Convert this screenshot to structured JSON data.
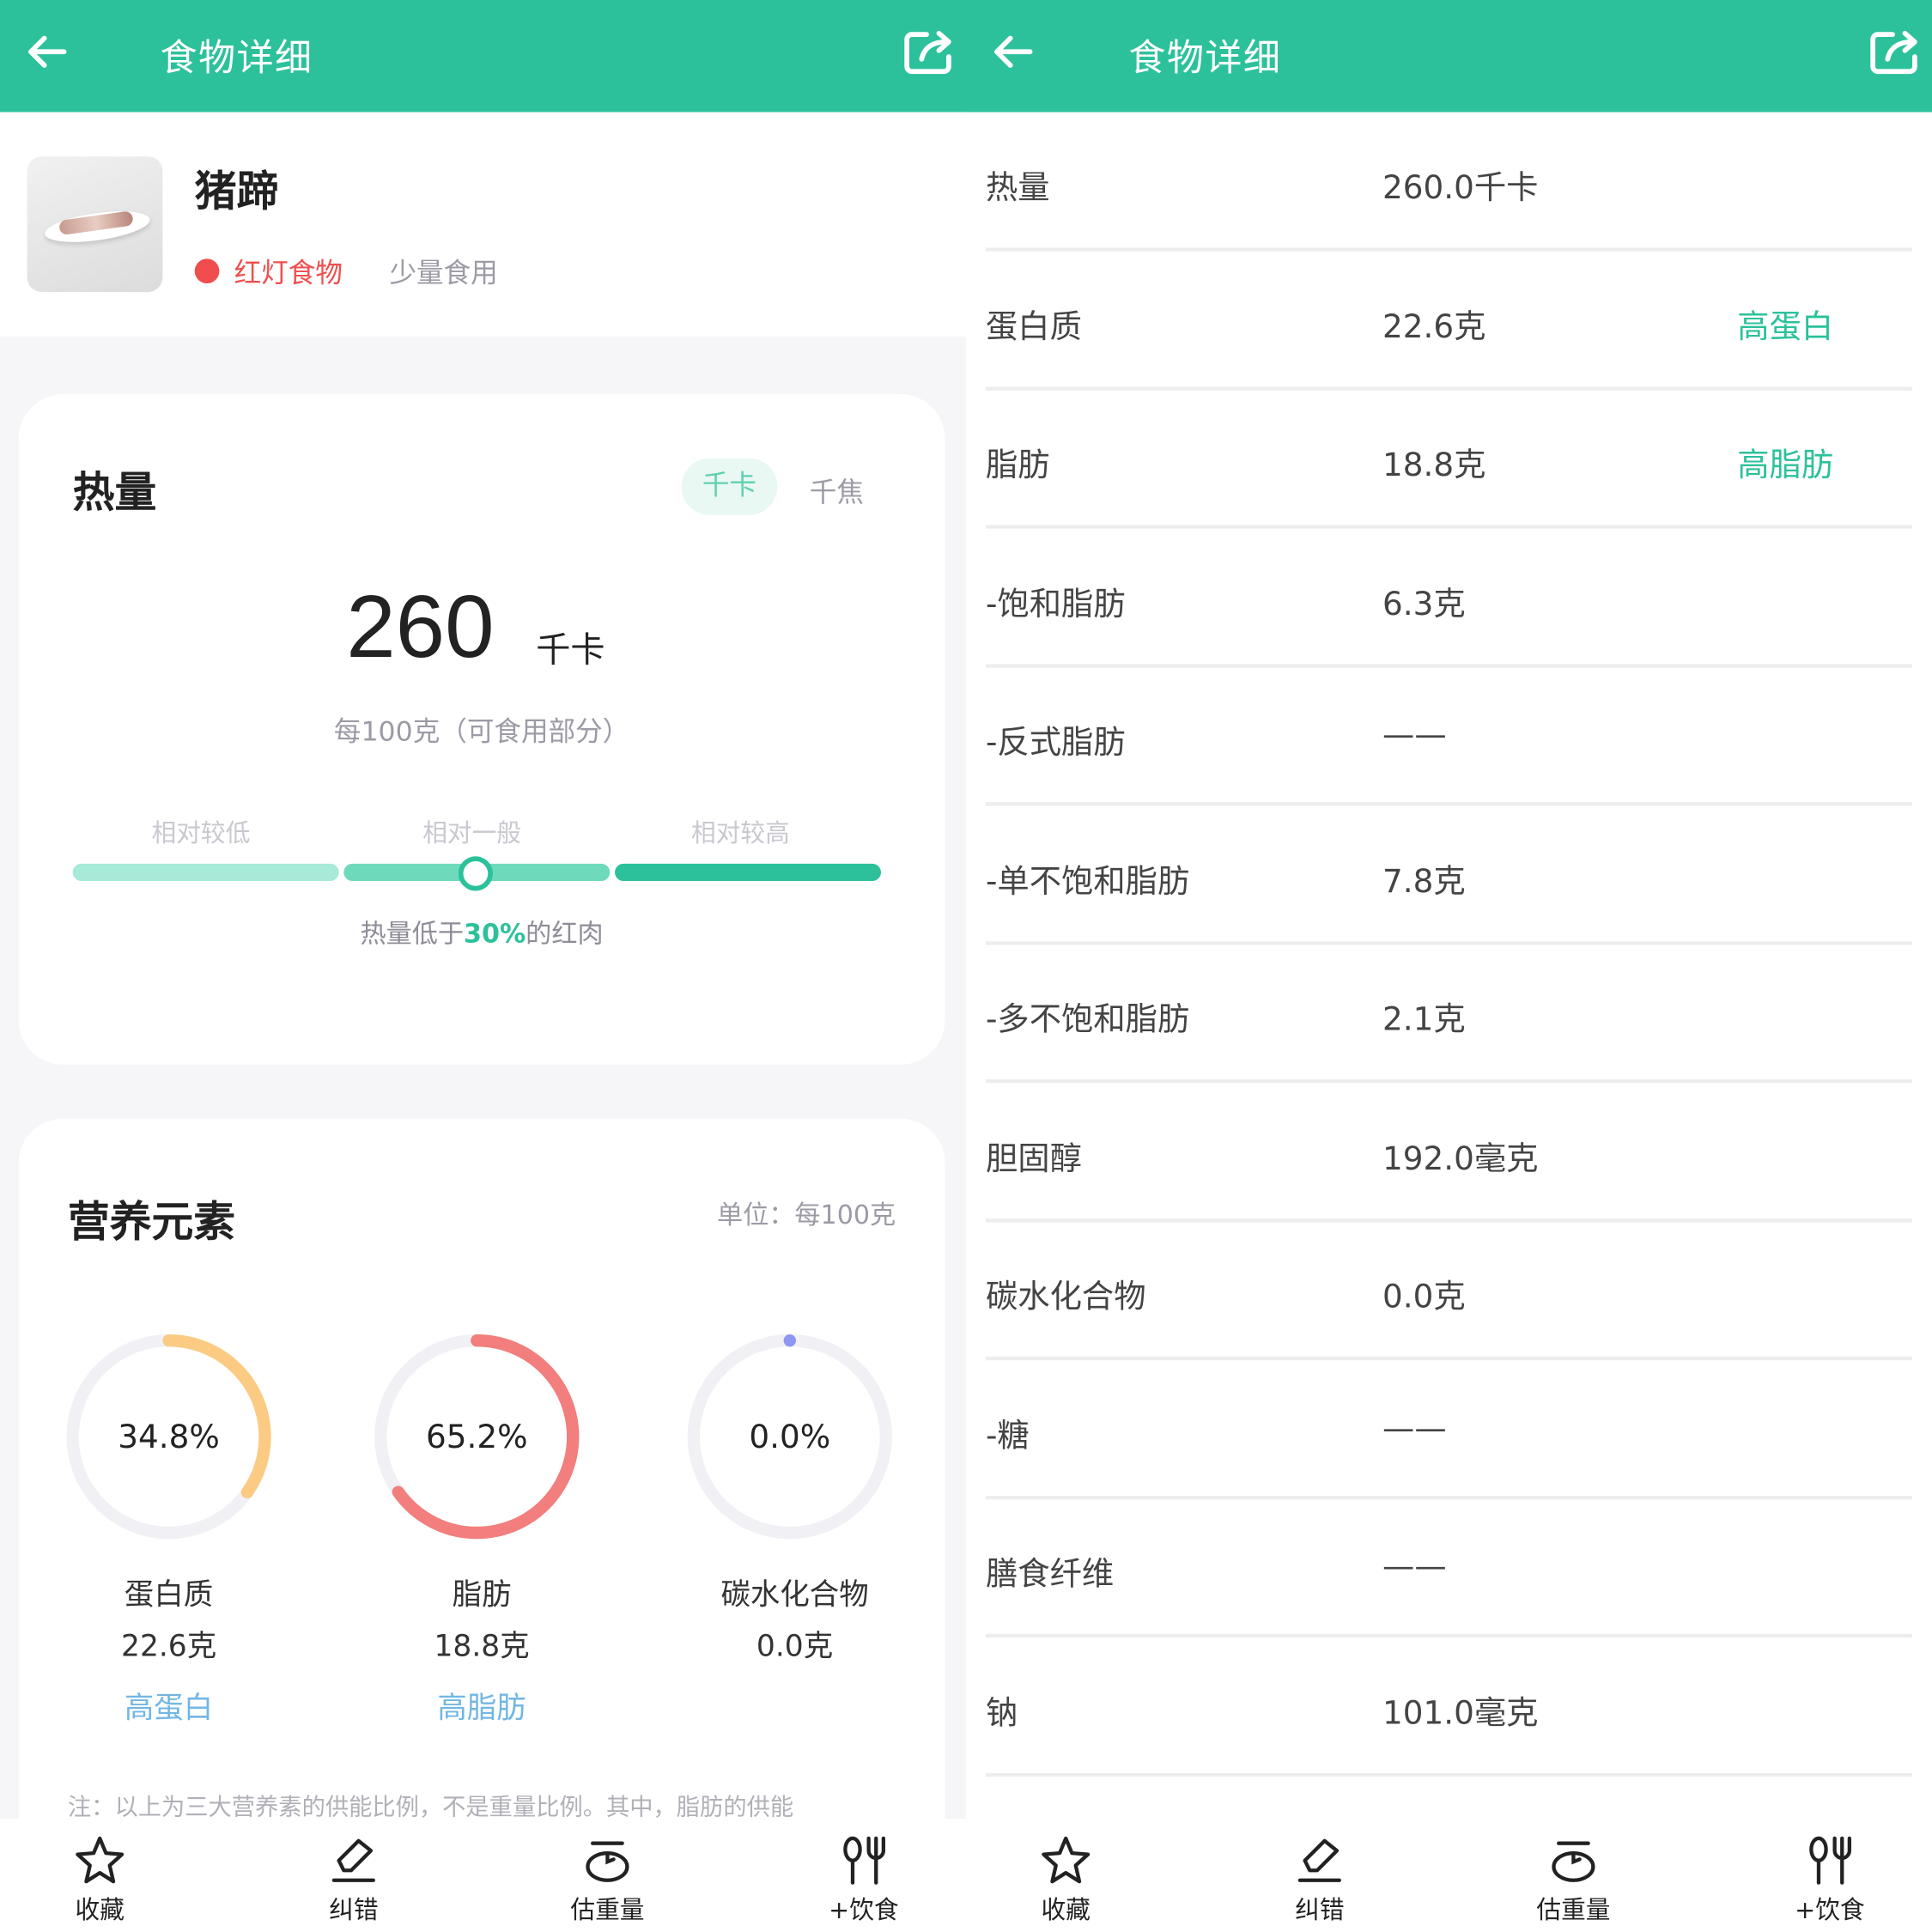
{
  "colors": {
    "accent": "#2cc19b",
    "red_light": "#f04e4e",
    "protein": "#fbcb84",
    "fat": "#f27e7e",
    "carb": "#8d96f0",
    "tag_blue": "#72b6e3"
  },
  "left": {
    "header": {
      "title": "食物详细",
      "back_icon": "arrow-left-icon",
      "share_icon": "share-icon"
    },
    "food": {
      "name": "猪蹄",
      "light_label": "红灯食物",
      "advice": "少量食用"
    },
    "energy": {
      "title": "热量",
      "unit_selected": "千卡",
      "unit_alt": "千焦",
      "value": "260",
      "value_unit": "千卡",
      "per": "每100克（可食用部分）",
      "levels": [
        "相对较低",
        "相对一般",
        "相对较高"
      ],
      "level_position": 0.5,
      "compare_prefix": "热量低于",
      "compare_pct": "30%",
      "compare_suffix": "的红肉"
    },
    "nutrients": {
      "title": "营养元素",
      "unit_note": "单位：每100克",
      "items": [
        {
          "pct": "34.8%",
          "fraction": 0.348,
          "name": "蛋白质",
          "value": "22.6克",
          "tag": "高蛋白"
        },
        {
          "pct": "65.2%",
          "fraction": 0.652,
          "name": "脂肪",
          "value": "18.8克",
          "tag": "高脂肪"
        },
        {
          "pct": "0.0%",
          "fraction": 0.0,
          "name": "碳水化合物",
          "value": "0.0克",
          "tag": ""
        }
      ],
      "footnote": "注：以上为三大营养素的供能比例，不是重量比例。其中，脂肪的供能"
    },
    "nav": [
      {
        "label": "收藏",
        "icon": "star-icon"
      },
      {
        "label": "纠错",
        "icon": "edit-icon"
      },
      {
        "label": "估重量",
        "icon": "scale-icon"
      },
      {
        "label": "+饮食",
        "icon": "fork-knife-icon"
      }
    ]
  },
  "right": {
    "header": {
      "title": "食物详细",
      "back_icon": "arrow-left-icon",
      "share_icon": "share-icon"
    },
    "rows": [
      {
        "k": "热量",
        "v": "260.0千卡",
        "t": ""
      },
      {
        "k": "蛋白质",
        "v": "22.6克",
        "t": "高蛋白"
      },
      {
        "k": "脂肪",
        "v": "18.8克",
        "t": "高脂肪"
      },
      {
        "k": "-饱和脂肪",
        "v": "6.3克",
        "t": ""
      },
      {
        "k": "-反式脂肪",
        "v": "——",
        "t": ""
      },
      {
        "k": "-单不饱和脂肪",
        "v": "7.8克",
        "t": ""
      },
      {
        "k": "-多不饱和脂肪",
        "v": "2.1克",
        "t": ""
      },
      {
        "k": "胆固醇",
        "v": "192.0毫克",
        "t": ""
      },
      {
        "k": "碳水化合物",
        "v": "0.0克",
        "t": ""
      },
      {
        "k": "-糖",
        "v": "——",
        "t": ""
      },
      {
        "k": "膳食纤维",
        "v": "——",
        "t": ""
      },
      {
        "k": "钠",
        "v": "101.0毫克",
        "t": ""
      }
    ],
    "nav": [
      {
        "label": "收藏",
        "icon": "star-icon"
      },
      {
        "label": "纠错",
        "icon": "edit-icon"
      },
      {
        "label": "估重量",
        "icon": "scale-icon"
      },
      {
        "label": "+饮食",
        "icon": "fork-knife-icon"
      }
    ]
  }
}
